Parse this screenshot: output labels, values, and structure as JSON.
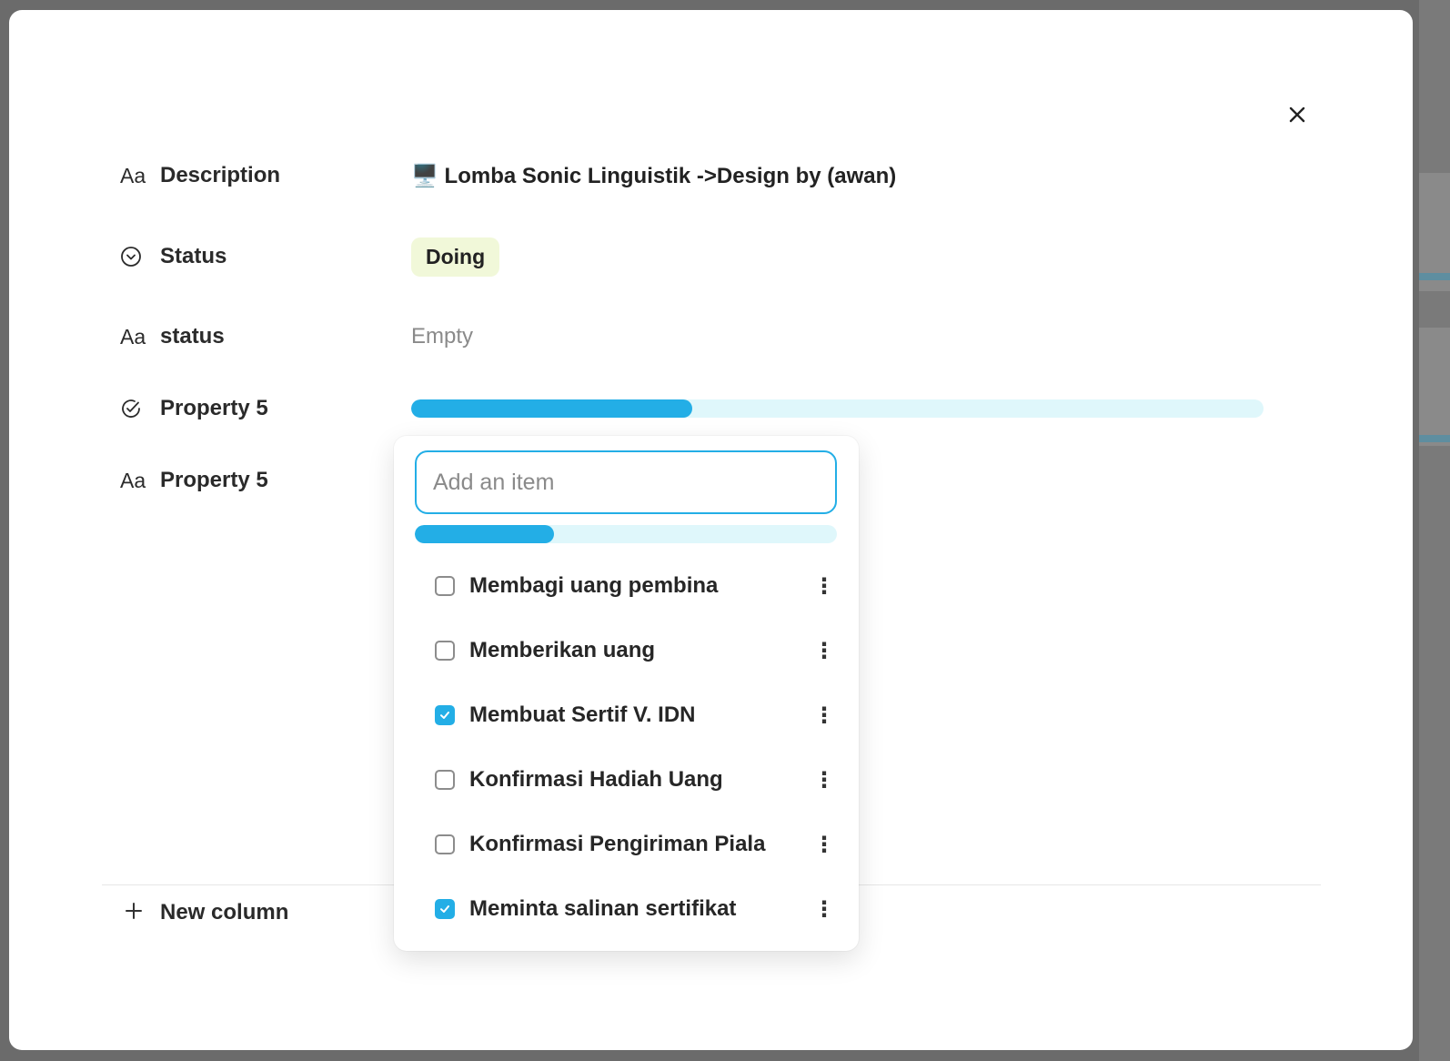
{
  "properties": {
    "description": {
      "icon": "text-type-icon",
      "icon_glyph": "Aa",
      "label": "Description",
      "value": "🖥️ Lomba Sonic Linguistik ->Design by (awan)"
    },
    "status": {
      "icon": "status-circle-icon",
      "label": "Status",
      "value": "Doing",
      "color": "#f1f8d9"
    },
    "status_text": {
      "icon": "text-type-icon",
      "icon_glyph": "Aa",
      "label": "status",
      "value": "Empty"
    },
    "property5_checklist": {
      "icon": "check-circle-icon",
      "label": "Property 5",
      "progress": 0.33
    },
    "property5_text": {
      "icon": "text-type-icon",
      "icon_glyph": "Aa",
      "label": "Property 5"
    }
  },
  "new_column": {
    "icon": "plus-icon",
    "label": "New column"
  },
  "checklist_popup": {
    "input_placeholder": "Add an item",
    "progress": 0.33,
    "items": [
      {
        "label": "Membagi uang pembina",
        "checked": false
      },
      {
        "label": "Memberikan uang",
        "checked": false
      },
      {
        "label": "Membuat Sertif V. IDN",
        "checked": true
      },
      {
        "label": "Konfirmasi Hadiah Uang",
        "checked": false
      },
      {
        "label": "Konfirmasi Pengiriman Piala",
        "checked": false
      },
      {
        "label": "Meminta salinan sertifikat",
        "checked": true
      }
    ]
  },
  "colors": {
    "accent": "#23aee6",
    "track": "#dff7fb"
  }
}
